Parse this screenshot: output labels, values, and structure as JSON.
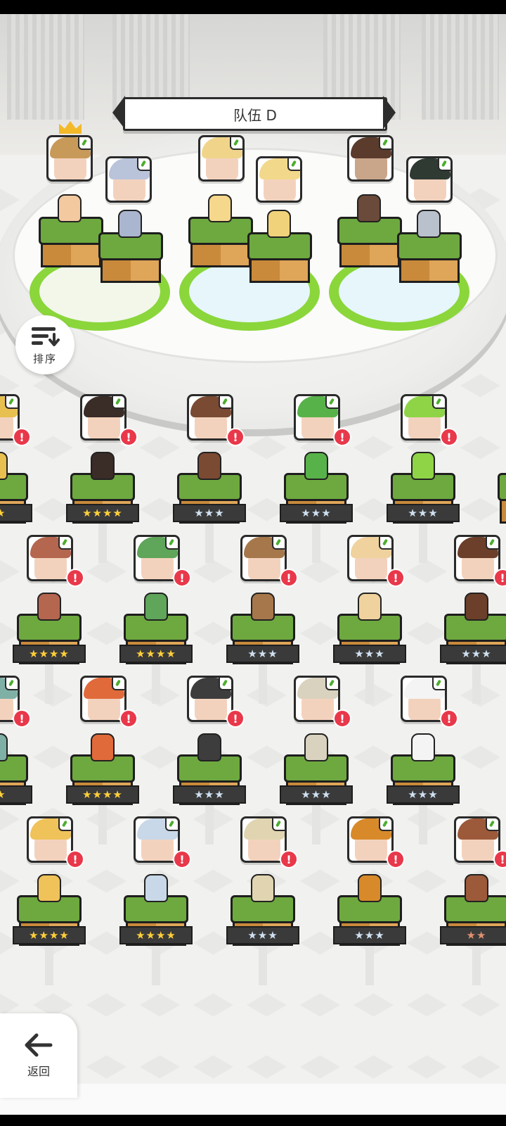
{
  "team": {
    "title": "队伍 D"
  },
  "buttons": {
    "sort_label": "排序",
    "back_label": "返回"
  },
  "rows": [
    {
      "stars": [
        "★★",
        "★★★★",
        "★★★",
        "★★★",
        "★★★",
        ""
      ],
      "tiers": [
        "gold",
        "gold",
        "silver",
        "silver",
        "silver",
        "silver"
      ]
    },
    {
      "stars": [
        "★★★★",
        "★★★★",
        "★★★",
        "★★★",
        "★★★"
      ],
      "tiers": [
        "gold",
        "gold",
        "silver",
        "silver",
        "silver"
      ]
    },
    {
      "stars": [
        "★★",
        "★★★★",
        "★★★",
        "★★★",
        "★★★"
      ],
      "tiers": [
        "gold",
        "gold",
        "silver",
        "silver",
        "silver"
      ]
    },
    {
      "stars": [
        "★★★★",
        "★★★★",
        "★★★",
        "★★★",
        "★★"
      ],
      "tiers": [
        "gold",
        "gold",
        "silver",
        "silver",
        "bronze"
      ]
    }
  ],
  "colors": {
    "warning": "#e8384a",
    "leaf": "#4cae2d",
    "grass": "#6ea940",
    "crown": "#f3b928"
  },
  "icons": [
    "sort-icon",
    "back-arrow-icon",
    "chevron-left-icon",
    "chevron-right-icon",
    "warning-icon",
    "leaf-icon",
    "crown-icon"
  ]
}
